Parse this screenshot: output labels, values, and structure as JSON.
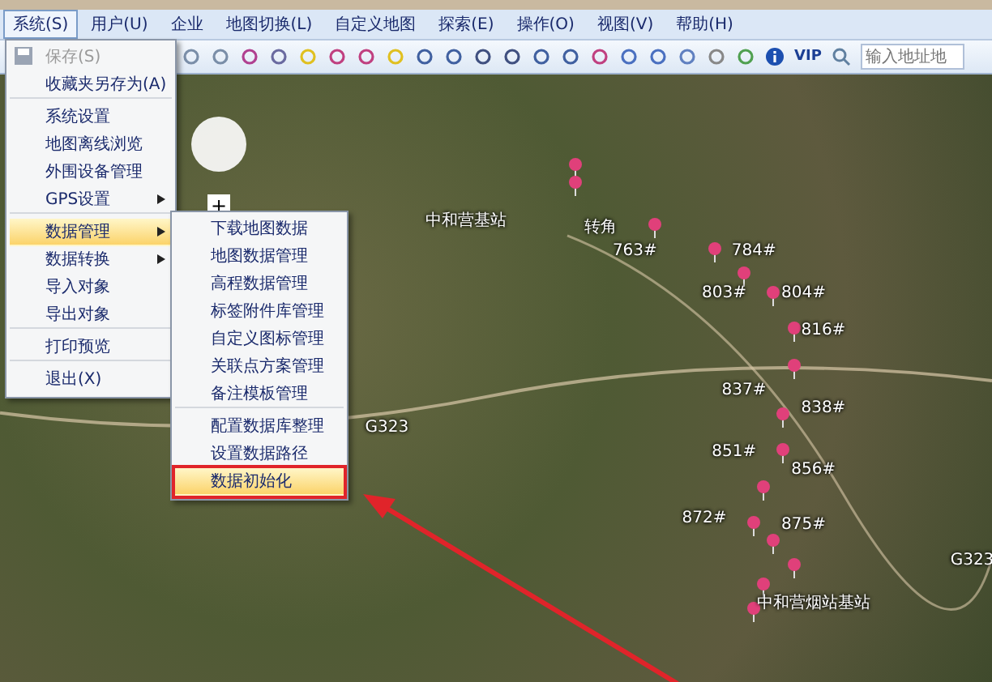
{
  "menu_bar": [
    {
      "label": "系统(S)",
      "selected": true
    },
    {
      "label": "用户(U)",
      "selected": false
    },
    {
      "label": "企业",
      "selected": false
    },
    {
      "label": "地图切换(L)",
      "selected": false
    },
    {
      "label": "自定义地图",
      "selected": false
    },
    {
      "label": "探索(E)",
      "selected": false
    },
    {
      "label": "操作(O)",
      "selected": false
    },
    {
      "label": "视图(V)",
      "selected": false
    },
    {
      "label": "帮助(H)",
      "selected": false
    }
  ],
  "toolbar": {
    "vip": "VIP",
    "search": {
      "placeholder": "输入地址地"
    }
  },
  "system_menu": [
    {
      "label": "保存(S)",
      "disabled": true,
      "submenu": false,
      "selected": false,
      "separator_after": false
    },
    {
      "label": "收藏夹另存为(A)",
      "disabled": false,
      "submenu": false,
      "selected": false,
      "separator_after": true
    },
    {
      "label": "系统设置",
      "disabled": false,
      "submenu": false,
      "selected": false,
      "separator_after": false
    },
    {
      "label": "地图离线浏览",
      "disabled": false,
      "submenu": false,
      "selected": false,
      "separator_after": false
    },
    {
      "label": "外围设备管理",
      "disabled": false,
      "submenu": false,
      "selected": false,
      "separator_after": false
    },
    {
      "label": "GPS设置",
      "disabled": false,
      "submenu": true,
      "selected": false,
      "separator_after": true
    },
    {
      "label": "数据管理",
      "disabled": false,
      "submenu": true,
      "selected": true,
      "separator_after": false
    },
    {
      "label": "数据转换",
      "disabled": false,
      "submenu": true,
      "selected": false,
      "separator_after": false
    },
    {
      "label": "导入对象",
      "disabled": false,
      "submenu": false,
      "selected": false,
      "separator_after": false
    },
    {
      "label": "导出对象",
      "disabled": false,
      "submenu": false,
      "selected": false,
      "separator_after": true
    },
    {
      "label": "打印预览",
      "disabled": false,
      "submenu": false,
      "selected": false,
      "separator_after": true
    },
    {
      "label": "退出(X)",
      "disabled": false,
      "submenu": false,
      "selected": false,
      "separator_after": false
    }
  ],
  "data_menu": [
    {
      "label": "下载地图数据",
      "selected": false,
      "separator_after": false
    },
    {
      "label": "地图数据管理",
      "selected": false,
      "separator_after": false
    },
    {
      "label": "高程数据管理",
      "selected": false,
      "separator_after": false
    },
    {
      "label": "标签附件库管理",
      "selected": false,
      "separator_after": false
    },
    {
      "label": "自定义图标管理",
      "selected": false,
      "separator_after": false
    },
    {
      "label": "关联点方案管理",
      "selected": false,
      "separator_after": false
    },
    {
      "label": "备注模板管理",
      "selected": false,
      "separator_after": true
    },
    {
      "label": "配置数据库整理",
      "selected": false,
      "separator_after": false
    },
    {
      "label": "设置数据路径",
      "selected": false,
      "separator_after": false
    },
    {
      "label": "数据初始化",
      "selected": true,
      "separator_after": false
    }
  ],
  "map": {
    "zoom_in": "+",
    "labels": [
      "中和营基站",
      "转角",
      "763#",
      "784#",
      "803#",
      "804#",
      "816#",
      "837#",
      "838#",
      "851#",
      "856#",
      "872#",
      "875#",
      "中和营烟站基站",
      "G323",
      "G323"
    ]
  }
}
